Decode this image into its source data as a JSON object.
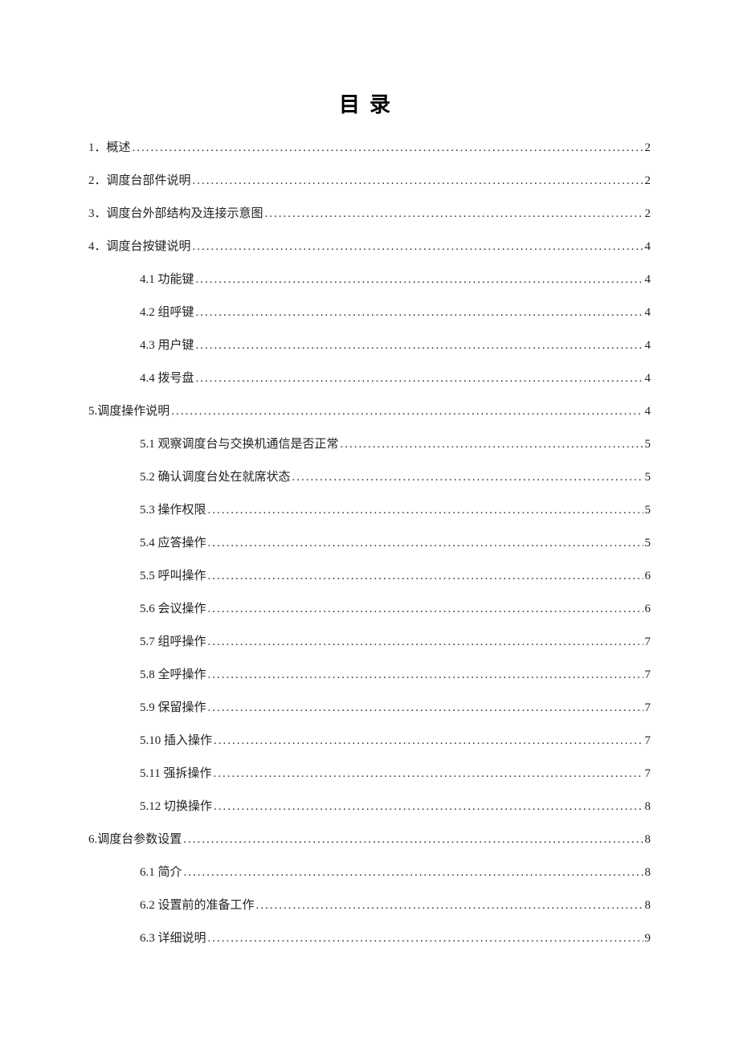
{
  "title": "目录",
  "toc": [
    {
      "level": 1,
      "label": "1．概述",
      "page": "2"
    },
    {
      "level": 1,
      "label": "2．调度台部件说明",
      "page": "2"
    },
    {
      "level": 1,
      "label": "3．调度台外部结构及连接示意图",
      "page": "2"
    },
    {
      "level": 1,
      "label": "4．调度台按键说明",
      "page": "4"
    },
    {
      "level": 2,
      "label": "4.1 功能键",
      "page": "4"
    },
    {
      "level": 2,
      "label": "4.2 组呼键",
      "page": "4"
    },
    {
      "level": 2,
      "label": "4.3 用户键",
      "page": "4"
    },
    {
      "level": 2,
      "label": "4.4 拨号盘",
      "page": "4"
    },
    {
      "level": 1,
      "label": "5.调度操作说明",
      "page": "4"
    },
    {
      "level": 2,
      "label": "5.1 观察调度台与交换机通信是否正常",
      "page": "5"
    },
    {
      "level": 2,
      "label": "5.2 确认调度台处在就席状态",
      "page": "5"
    },
    {
      "level": 2,
      "label": "5.3 操作权限",
      "page": "5"
    },
    {
      "level": 2,
      "label": "5.4 应答操作",
      "page": "5"
    },
    {
      "level": 2,
      "label": "5.5 呼叫操作",
      "page": "6"
    },
    {
      "level": 2,
      "label": "5.6 会议操作",
      "page": "6"
    },
    {
      "level": 2,
      "label": "5.7 组呼操作",
      "page": "7"
    },
    {
      "level": 2,
      "label": "5.8 全呼操作",
      "page": "7"
    },
    {
      "level": 2,
      "label": "5.9 保留操作",
      "page": "7"
    },
    {
      "level": 2,
      "label": "5.10 插入操作",
      "page": "7"
    },
    {
      "level": 2,
      "label": "5.11 强拆操作",
      "page": "7"
    },
    {
      "level": 2,
      "label": "5.12 切换操作",
      "page": "8"
    },
    {
      "level": 1,
      "label": "6.调度台参数设置",
      "page": "8"
    },
    {
      "level": 2,
      "label": "6.1 简介",
      "page": "8"
    },
    {
      "level": 2,
      "label": "6.2 设置前的准备工作",
      "page": "8"
    },
    {
      "level": 2,
      "label": "6.3 详细说明",
      "page": "9"
    }
  ]
}
